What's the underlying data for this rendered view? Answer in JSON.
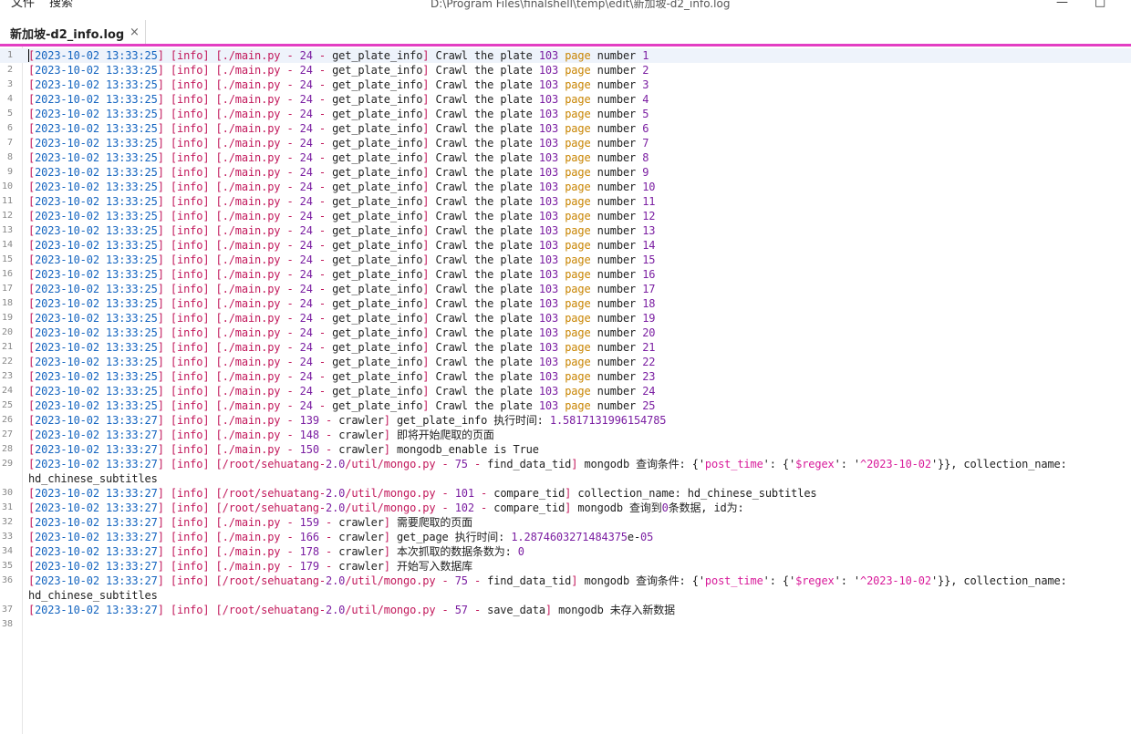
{
  "menu": {
    "file": "文件",
    "search": "搜索"
  },
  "window": {
    "title": "D:\\Program Files\\finalshell\\temp\\edit\\新加坡-d2_info.log",
    "minimize_glyph": "—",
    "maximize_glyph": "□"
  },
  "tab": {
    "label": "新加坡-d2_info.log",
    "close_glyph": "×",
    "accent_color": "#e33ec3"
  },
  "editor": {
    "current_line": 1,
    "lines": [
      {
        "n": 1,
        "time": "13:33:25",
        "file": "./main.py",
        "lineno": "24",
        "func": "get_plate_info",
        "msg": "crawl",
        "plate": "103",
        "page": "1"
      },
      {
        "n": 2,
        "time": "13:33:25",
        "file": "./main.py",
        "lineno": "24",
        "func": "get_plate_info",
        "msg": "crawl",
        "plate": "103",
        "page": "2"
      },
      {
        "n": 3,
        "time": "13:33:25",
        "file": "./main.py",
        "lineno": "24",
        "func": "get_plate_info",
        "msg": "crawl",
        "plate": "103",
        "page": "3"
      },
      {
        "n": 4,
        "time": "13:33:25",
        "file": "./main.py",
        "lineno": "24",
        "func": "get_plate_info",
        "msg": "crawl",
        "plate": "103",
        "page": "4"
      },
      {
        "n": 5,
        "time": "13:33:25",
        "file": "./main.py",
        "lineno": "24",
        "func": "get_plate_info",
        "msg": "crawl",
        "plate": "103",
        "page": "5"
      },
      {
        "n": 6,
        "time": "13:33:25",
        "file": "./main.py",
        "lineno": "24",
        "func": "get_plate_info",
        "msg": "crawl",
        "plate": "103",
        "page": "6"
      },
      {
        "n": 7,
        "time": "13:33:25",
        "file": "./main.py",
        "lineno": "24",
        "func": "get_plate_info",
        "msg": "crawl",
        "plate": "103",
        "page": "7"
      },
      {
        "n": 8,
        "time": "13:33:25",
        "file": "./main.py",
        "lineno": "24",
        "func": "get_plate_info",
        "msg": "crawl",
        "plate": "103",
        "page": "8"
      },
      {
        "n": 9,
        "time": "13:33:25",
        "file": "./main.py",
        "lineno": "24",
        "func": "get_plate_info",
        "msg": "crawl",
        "plate": "103",
        "page": "9"
      },
      {
        "n": 10,
        "time": "13:33:25",
        "file": "./main.py",
        "lineno": "24",
        "func": "get_plate_info",
        "msg": "crawl",
        "plate": "103",
        "page": "10"
      },
      {
        "n": 11,
        "time": "13:33:25",
        "file": "./main.py",
        "lineno": "24",
        "func": "get_plate_info",
        "msg": "crawl",
        "plate": "103",
        "page": "11"
      },
      {
        "n": 12,
        "time": "13:33:25",
        "file": "./main.py",
        "lineno": "24",
        "func": "get_plate_info",
        "msg": "crawl",
        "plate": "103",
        "page": "12"
      },
      {
        "n": 13,
        "time": "13:33:25",
        "file": "./main.py",
        "lineno": "24",
        "func": "get_plate_info",
        "msg": "crawl",
        "plate": "103",
        "page": "13"
      },
      {
        "n": 14,
        "time": "13:33:25",
        "file": "./main.py",
        "lineno": "24",
        "func": "get_plate_info",
        "msg": "crawl",
        "plate": "103",
        "page": "14"
      },
      {
        "n": 15,
        "time": "13:33:25",
        "file": "./main.py",
        "lineno": "24",
        "func": "get_plate_info",
        "msg": "crawl",
        "plate": "103",
        "page": "15"
      },
      {
        "n": 16,
        "time": "13:33:25",
        "file": "./main.py",
        "lineno": "24",
        "func": "get_plate_info",
        "msg": "crawl",
        "plate": "103",
        "page": "16"
      },
      {
        "n": 17,
        "time": "13:33:25",
        "file": "./main.py",
        "lineno": "24",
        "func": "get_plate_info",
        "msg": "crawl",
        "plate": "103",
        "page": "17"
      },
      {
        "n": 18,
        "time": "13:33:25",
        "file": "./main.py",
        "lineno": "24",
        "func": "get_plate_info",
        "msg": "crawl",
        "plate": "103",
        "page": "18"
      },
      {
        "n": 19,
        "time": "13:33:25",
        "file": "./main.py",
        "lineno": "24",
        "func": "get_plate_info",
        "msg": "crawl",
        "plate": "103",
        "page": "19"
      },
      {
        "n": 20,
        "time": "13:33:25",
        "file": "./main.py",
        "lineno": "24",
        "func": "get_plate_info",
        "msg": "crawl",
        "plate": "103",
        "page": "20"
      },
      {
        "n": 21,
        "time": "13:33:25",
        "file": "./main.py",
        "lineno": "24",
        "func": "get_plate_info",
        "msg": "crawl",
        "plate": "103",
        "page": "21"
      },
      {
        "n": 22,
        "time": "13:33:25",
        "file": "./main.py",
        "lineno": "24",
        "func": "get_plate_info",
        "msg": "crawl",
        "plate": "103",
        "page": "22"
      },
      {
        "n": 23,
        "time": "13:33:25",
        "file": "./main.py",
        "lineno": "24",
        "func": "get_plate_info",
        "msg": "crawl",
        "plate": "103",
        "page": "23"
      },
      {
        "n": 24,
        "time": "13:33:25",
        "file": "./main.py",
        "lineno": "24",
        "func": "get_plate_info",
        "msg": "crawl",
        "plate": "103",
        "page": "24"
      },
      {
        "n": 25,
        "time": "13:33:25",
        "file": "./main.py",
        "lineno": "24",
        "func": "get_plate_info",
        "msg": "crawl",
        "plate": "103",
        "page": "25"
      },
      {
        "n": 26,
        "time": "13:33:27",
        "file": "./main.py",
        "lineno": "139",
        "func": "crawler",
        "msg": "text",
        "text": "get_plate_info 执行时间: 1.5817131996154785"
      },
      {
        "n": 27,
        "time": "13:33:27",
        "file": "./main.py",
        "lineno": "148",
        "func": "crawler",
        "msg": "text",
        "text": "即将开始爬取的页面"
      },
      {
        "n": 28,
        "time": "13:33:27",
        "file": "./main.py",
        "lineno": "150",
        "func": "crawler",
        "msg": "text",
        "text": "mongodb_enable is True"
      },
      {
        "n": 29,
        "time": "13:33:27",
        "file": "/root/sehuatang-2.0/util/mongo.py",
        "lineno": "75",
        "func": "find_data_tid",
        "msg": "query",
        "text": "mongodb 查询条件: {'post_time': {'$regex': '^2023-10-02'}}, collection_name:",
        "wrap": "hd_chinese_subtitles"
      },
      {
        "n": 30,
        "time": "13:33:27",
        "file": "/root/sehuatang-2.0/util/mongo.py",
        "lineno": "101",
        "func": "compare_tid",
        "msg": "text",
        "text": "collection_name: hd_chinese_subtitles"
      },
      {
        "n": 31,
        "time": "13:33:27",
        "file": "/root/sehuatang-2.0/util/mongo.py",
        "lineno": "102",
        "func": "compare_tid",
        "msg": "text",
        "text": "mongodb 查询到0条数据, id为:"
      },
      {
        "n": 32,
        "time": "13:33:27",
        "file": "./main.py",
        "lineno": "159",
        "func": "crawler",
        "msg": "text",
        "text": "需要爬取的页面"
      },
      {
        "n": 33,
        "time": "13:33:27",
        "file": "./main.py",
        "lineno": "166",
        "func": "crawler",
        "msg": "text",
        "text": "get_page 执行时间: 1.2874603271484375e-05"
      },
      {
        "n": 34,
        "time": "13:33:27",
        "file": "./main.py",
        "lineno": "178",
        "func": "crawler",
        "msg": "text",
        "text": "本次抓取的数据条数为: 0"
      },
      {
        "n": 35,
        "time": "13:33:27",
        "file": "./main.py",
        "lineno": "179",
        "func": "crawler",
        "msg": "text",
        "text": "开始写入数据库"
      },
      {
        "n": 36,
        "time": "13:33:27",
        "file": "/root/sehuatang-2.0/util/mongo.py",
        "lineno": "75",
        "func": "find_data_tid",
        "msg": "query",
        "text": "mongodb 查询条件: {'post_time': {'$regex': '^2023-10-02'}}, collection_name:",
        "wrap": "hd_chinese_subtitles"
      },
      {
        "n": 37,
        "time": "13:33:27",
        "file": "/root/sehuatang-2.0/util/mongo.py",
        "lineno": "57",
        "func": "save_data",
        "msg": "text",
        "text": "mongodb 未存入新数据"
      },
      {
        "n": 38,
        "msg": "empty"
      }
    ]
  },
  "log": {
    "date": "2023-10-02",
    "level": "info",
    "crawl_word": "Crawl",
    "the_word": "the",
    "plate_word": "plate",
    "page_word": "page",
    "number_word": "number"
  }
}
